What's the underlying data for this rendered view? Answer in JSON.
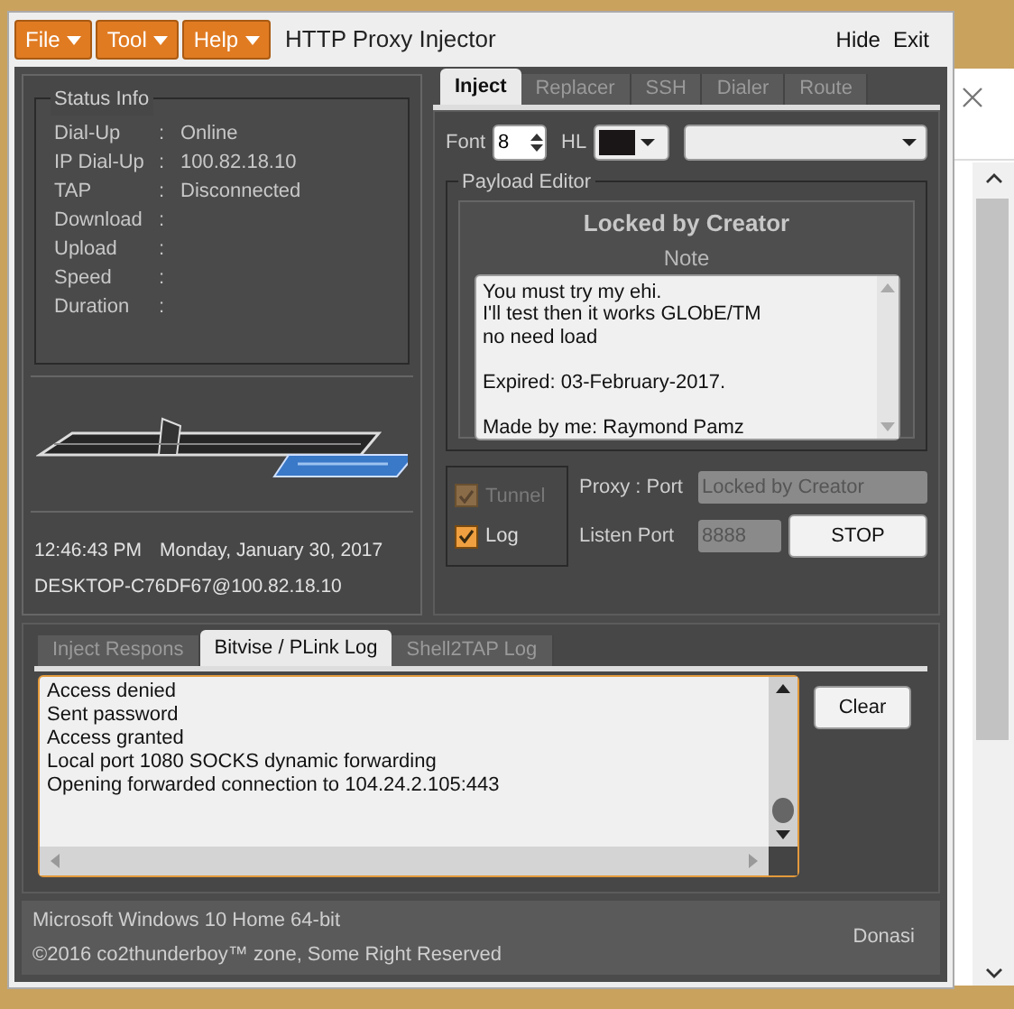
{
  "window": {
    "title": "HTTP Proxy Injector",
    "actions": [
      "Hide",
      "Exit"
    ]
  },
  "menu": [
    {
      "label": "File"
    },
    {
      "label": "Tool"
    },
    {
      "label": "Help"
    }
  ],
  "status_info": {
    "title": "Status Info",
    "separator": ":",
    "rows": [
      {
        "label": "Dial-Up",
        "value": "Online"
      },
      {
        "label": "IP Dial-Up",
        "value": "100.82.18.10"
      },
      {
        "label": "TAP",
        "value": "Disconnected"
      },
      {
        "label": "Download"
      },
      {
        "label": "Upload"
      },
      {
        "label": "Speed"
      },
      {
        "label": "Duration"
      }
    ]
  },
  "clock": {
    "time": "12:46:43 PM",
    "date": "Monday, January 30, 2017",
    "host": "DESKTOP-C76DF67@100.82.18.10"
  },
  "tabs": [
    {
      "label": "Inject",
      "selected": true
    },
    {
      "label": "Replacer",
      "selected": false
    },
    {
      "label": "SSH",
      "selected": false
    },
    {
      "label": "Dialer",
      "selected": false
    },
    {
      "label": "Route",
      "selected": false
    }
  ],
  "inject": {
    "font_label": "Font",
    "font_size": "8",
    "hl_label": "HL",
    "payload_editor": {
      "title": "Payload Editor",
      "heading": "Locked by Creator",
      "note_label": "Note",
      "note": "You must try my ehi.\nI'll test then it works GLObE/TM\nno need load\n\nExpired: 03-February-2017.\n\nMade by me: Raymond Pamz"
    },
    "options": [
      {
        "label": "Tunnel",
        "checked": true,
        "disabled": true
      },
      {
        "label": "Log",
        "checked": true,
        "disabled": false
      }
    ],
    "proxy_label": "Proxy : Port",
    "proxy_value": "Locked by Creator",
    "listen_label": "Listen Port",
    "listen_value": "8888",
    "stop_button": "STOP"
  },
  "log_tabs": [
    {
      "label": "Inject Respons",
      "selected": false
    },
    {
      "label": "Bitvise / PLink Log",
      "selected": true
    },
    {
      "label": "Shell2TAP Log",
      "selected": false
    }
  ],
  "log_lines": [
    "Access denied",
    "Sent password",
    "Access granted",
    "Local port 1080 SOCKS dynamic forwarding",
    "Opening forwarded connection to 104.24.2.105:443"
  ],
  "clear_button": "Clear",
  "footer": {
    "os": "Microsoft Windows 10 Home 64-bit",
    "copyright": "©2016 co2thunderboy™ zone, Some Right Reserved",
    "donate": "Donasi"
  }
}
